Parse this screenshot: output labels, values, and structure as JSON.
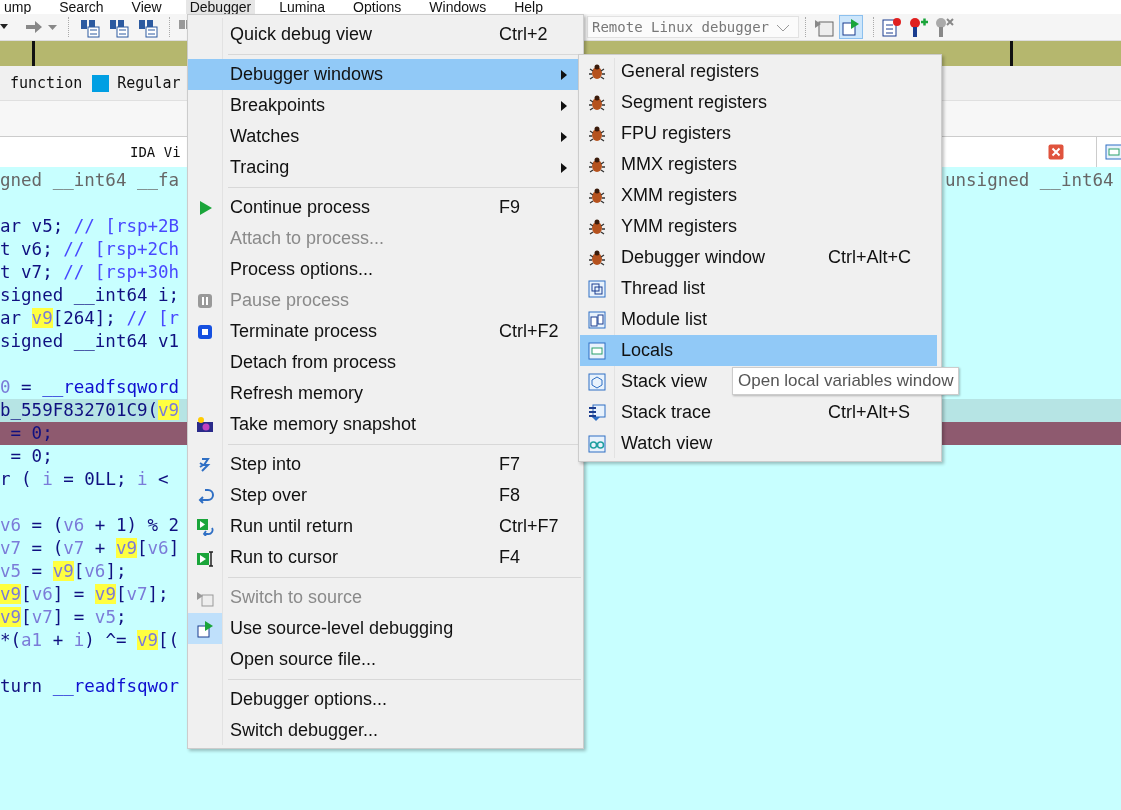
{
  "menubar": [
    {
      "label": "ump",
      "selected": false
    },
    {
      "label": "Search",
      "selected": false
    },
    {
      "label": "View",
      "selected": false
    },
    {
      "label": "Debugger",
      "selected": true
    },
    {
      "label": "Lumina",
      "selected": false
    },
    {
      "label": "Options",
      "selected": false
    },
    {
      "label": "Windows",
      "selected": false
    },
    {
      "label": "Help",
      "selected": false
    }
  ],
  "toolbar": {
    "debugger": "Remote Linux debugger",
    "source_level_on": true
  },
  "legend": [
    {
      "label": "function"
    },
    {
      "label": "Regular",
      "color": "#009fe3"
    }
  ],
  "tab": {
    "title": "IDA Vi"
  },
  "code_lines": [
    {
      "kind": "normal",
      "segments": [
        {
          "text": "gned __int64 __fa",
          "kind": "header"
        }
      ],
      "tail": "unsigned __int64"
    },
    {
      "kind": "blank"
    },
    {
      "kind": "normal",
      "segments": [
        {
          "text": "ar v5; ",
          "kind": "code"
        },
        {
          "text": "// [rsp+2B",
          "kind": "comment"
        }
      ]
    },
    {
      "kind": "normal",
      "segments": [
        {
          "text": "t v6; ",
          "kind": "code"
        },
        {
          "text": "// [rsp+2Ch",
          "kind": "comment"
        }
      ]
    },
    {
      "kind": "normal",
      "segments": [
        {
          "text": "t v7; ",
          "kind": "code"
        },
        {
          "text": "// [rsp+30h",
          "kind": "comment"
        }
      ]
    },
    {
      "kind": "normal",
      "segments": [
        {
          "text": "signed __int64 i;",
          "kind": "code"
        }
      ]
    },
    {
      "kind": "normal",
      "segments": [
        {
          "text": "ar ",
          "kind": "code"
        },
        {
          "text": "v9",
          "kind": "highlight"
        },
        {
          "text": "[264]; ",
          "kind": "code"
        },
        {
          "text": "// [r",
          "kind": "comment"
        }
      ]
    },
    {
      "kind": "normal",
      "segments": [
        {
          "text": "signed __int64 v1",
          "kind": "code"
        }
      ]
    },
    {
      "kind": "blank"
    },
    {
      "kind": "normal",
      "segments": [
        {
          "text": "0",
          "kind": "variable"
        },
        {
          "text": " = ",
          "kind": "code"
        },
        {
          "text": "__readfsqword",
          "kind": "function"
        }
      ]
    },
    {
      "kind": "current",
      "segments": [
        {
          "text": "b_559F832701C9(",
          "kind": "code"
        },
        {
          "text": "v9",
          "kind": "highlight"
        }
      ]
    },
    {
      "kind": "breakpoint",
      "segments": [
        {
          "text": " = 0;",
          "kind": "code"
        }
      ]
    },
    {
      "kind": "normal",
      "segments": [
        {
          "text": " = 0;",
          "kind": "code"
        }
      ]
    },
    {
      "kind": "normal",
      "segments": [
        {
          "text": "r ( ",
          "kind": "code"
        },
        {
          "text": "i",
          "kind": "variable"
        },
        {
          "text": " = 0LL; ",
          "kind": "code"
        },
        {
          "text": "i",
          "kind": "variable"
        },
        {
          "text": " <",
          "kind": "code"
        }
      ]
    },
    {
      "kind": "blank"
    },
    {
      "kind": "normal",
      "segments": [
        {
          "text": "v6",
          "kind": "variable"
        },
        {
          "text": " = (",
          "kind": "code"
        },
        {
          "text": "v6",
          "kind": "variable"
        },
        {
          "text": " + 1) % 2",
          "kind": "code"
        }
      ]
    },
    {
      "kind": "normal",
      "segments": [
        {
          "text": "v7",
          "kind": "variable"
        },
        {
          "text": " = (",
          "kind": "code"
        },
        {
          "text": "v7",
          "kind": "variable"
        },
        {
          "text": " + ",
          "kind": "code"
        },
        {
          "text": "v9",
          "kind": "highlight"
        },
        {
          "text": "[",
          "kind": "code"
        },
        {
          "text": "v6",
          "kind": "variable"
        },
        {
          "text": "]",
          "kind": "code"
        }
      ]
    },
    {
      "kind": "normal",
      "segments": [
        {
          "text": "v5",
          "kind": "variable"
        },
        {
          "text": " = ",
          "kind": "code"
        },
        {
          "text": "v9",
          "kind": "highlight"
        },
        {
          "text": "[",
          "kind": "code"
        },
        {
          "text": "v6",
          "kind": "variable"
        },
        {
          "text": "];",
          "kind": "code"
        }
      ]
    },
    {
      "kind": "normal",
      "segments": [
        {
          "text": "v9",
          "kind": "highlight"
        },
        {
          "text": "[",
          "kind": "code"
        },
        {
          "text": "v6",
          "kind": "variable"
        },
        {
          "text": "] = ",
          "kind": "code"
        },
        {
          "text": "v9",
          "kind": "highlight"
        },
        {
          "text": "[",
          "kind": "code"
        },
        {
          "text": "v7",
          "kind": "variable"
        },
        {
          "text": "];",
          "kind": "code"
        }
      ]
    },
    {
      "kind": "normal",
      "segments": [
        {
          "text": "v9",
          "kind": "highlight"
        },
        {
          "text": "[",
          "kind": "code"
        },
        {
          "text": "v7",
          "kind": "variable"
        },
        {
          "text": "] = ",
          "kind": "code"
        },
        {
          "text": "v5",
          "kind": "variable"
        },
        {
          "text": ";",
          "kind": "code"
        }
      ]
    },
    {
      "kind": "normal",
      "segments": [
        {
          "text": "*(",
          "kind": "code"
        },
        {
          "text": "a1",
          "kind": "variable"
        },
        {
          "text": " + ",
          "kind": "code"
        },
        {
          "text": "i",
          "kind": "variable"
        },
        {
          "text": ") ^= ",
          "kind": "code"
        },
        {
          "text": "v9",
          "kind": "highlight"
        },
        {
          "text": "[(",
          "kind": "code"
        }
      ]
    },
    {
      "kind": "blank"
    },
    {
      "kind": "normal",
      "segments": [
        {
          "text": "turn ",
          "kind": "code"
        },
        {
          "text": "__readfsqwor",
          "kind": "function"
        }
      ]
    }
  ],
  "debugger_menu": {
    "items": [
      {
        "kind": "item",
        "label": "Quick debug view",
        "shortcut": "Ctrl+2",
        "submenu": false,
        "disabled": false,
        "selected": false,
        "checked": false
      },
      {
        "kind": "separator"
      },
      {
        "kind": "item",
        "label": "Debugger windows",
        "submenu": true,
        "disabled": false,
        "selected": true,
        "checked": false
      },
      {
        "kind": "item",
        "label": "Breakpoints",
        "submenu": true,
        "disabled": false,
        "selected": false,
        "checked": false
      },
      {
        "kind": "item",
        "label": "Watches",
        "submenu": true,
        "disabled": false,
        "selected": false,
        "checked": false
      },
      {
        "kind": "item",
        "label": "Tracing",
        "submenu": true,
        "disabled": false,
        "selected": false,
        "checked": false
      },
      {
        "kind": "separator"
      },
      {
        "kind": "item",
        "label": "Continue process",
        "shortcut": "F9",
        "submenu": false,
        "disabled": false,
        "selected": false,
        "checked": false
      },
      {
        "kind": "item",
        "label": "Attach to process...",
        "submenu": false,
        "disabled": true,
        "selected": false,
        "checked": false
      },
      {
        "kind": "item",
        "label": "Process options...",
        "submenu": false,
        "disabled": false,
        "selected": false,
        "checked": false
      },
      {
        "kind": "item",
        "label": "Pause process",
        "submenu": false,
        "disabled": true,
        "selected": false,
        "checked": false
      },
      {
        "kind": "item",
        "label": "Terminate process",
        "shortcut": "Ctrl+F2",
        "submenu": false,
        "disabled": false,
        "selected": false,
        "checked": false
      },
      {
        "kind": "item",
        "label": "Detach from process",
        "submenu": false,
        "disabled": false,
        "selected": false,
        "checked": false
      },
      {
        "kind": "item",
        "label": "Refresh memory",
        "submenu": false,
        "disabled": false,
        "selected": false,
        "checked": false
      },
      {
        "kind": "item",
        "label": "Take memory snapshot",
        "submenu": false,
        "disabled": false,
        "selected": false,
        "checked": false
      },
      {
        "kind": "separator"
      },
      {
        "kind": "item",
        "label": "Step into",
        "shortcut": "F7",
        "submenu": false,
        "disabled": false,
        "selected": false,
        "checked": false
      },
      {
        "kind": "item",
        "label": "Step over",
        "shortcut": "F8",
        "submenu": false,
        "disabled": false,
        "selected": false,
        "checked": false
      },
      {
        "kind": "item",
        "label": "Run until return",
        "shortcut": "Ctrl+F7",
        "submenu": false,
        "disabled": false,
        "selected": false,
        "checked": false
      },
      {
        "kind": "item",
        "label": "Run to cursor",
        "shortcut": "F4",
        "submenu": false,
        "disabled": false,
        "selected": false,
        "checked": false
      },
      {
        "kind": "separator"
      },
      {
        "kind": "item",
        "label": "Switch to source",
        "submenu": false,
        "disabled": true,
        "selected": false,
        "checked": false
      },
      {
        "kind": "item",
        "label": "Use source-level debugging",
        "submenu": false,
        "disabled": false,
        "selected": false,
        "checked": true
      },
      {
        "kind": "item",
        "label": "Open source file...",
        "submenu": false,
        "disabled": false,
        "selected": false,
        "checked": false
      },
      {
        "kind": "separator"
      },
      {
        "kind": "item",
        "label": "Debugger options...",
        "submenu": false,
        "disabled": false,
        "selected": false,
        "checked": false
      },
      {
        "kind": "item",
        "label": "Switch debugger...",
        "submenu": false,
        "disabled": false,
        "selected": false,
        "checked": false
      }
    ]
  },
  "windows_submenu": {
    "items": [
      {
        "label": "General registers",
        "selected": false
      },
      {
        "label": "Segment registers",
        "selected": false
      },
      {
        "label": "FPU registers",
        "selected": false
      },
      {
        "label": "MMX registers",
        "selected": false
      },
      {
        "label": "XMM registers",
        "selected": false
      },
      {
        "label": "YMM registers",
        "selected": false
      },
      {
        "label": "Debugger window",
        "shortcut": "Ctrl+Alt+C",
        "selected": false
      },
      {
        "label": "Thread list",
        "selected": false
      },
      {
        "label": "Module list",
        "selected": false
      },
      {
        "label": "Locals",
        "selected": true
      },
      {
        "label": "Stack view",
        "selected": false
      },
      {
        "label": "Stack trace",
        "shortcut": "Ctrl+Alt+S",
        "selected": false
      },
      {
        "label": "Watch view",
        "selected": false
      }
    ]
  },
  "tooltip": {
    "text": "Open local variables window"
  }
}
